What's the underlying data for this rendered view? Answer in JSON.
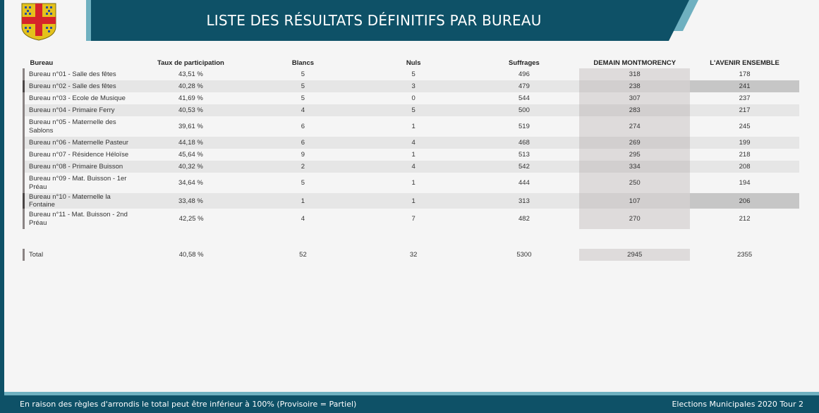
{
  "header": {
    "title": "LISTE DES RÉSULTATS DÉFINITIFS PAR BUREAU",
    "banner_color": "#0e5167",
    "accent_color": "#6fb0c0"
  },
  "logo": {
    "icon": "coat-of-arms-icon"
  },
  "table": {
    "columns": [
      "Bureau",
      "Taux de participation",
      "Blancs",
      "Nuls",
      "Suffrages",
      "DEMAIN MONTMORENCY",
      "L'AVENIR ENSEMBLE"
    ],
    "rows": [
      [
        "Bureau n°01 - Salle des fêtes",
        "43,51 %",
        "5",
        "5",
        "496",
        "318",
        "178"
      ],
      [
        "Bureau n°02 - Salle des fêtes",
        "40,28 %",
        "5",
        "3",
        "479",
        "238",
        "241"
      ],
      [
        "Bureau n°03 - Ecole de Musique",
        "41,69 %",
        "5",
        "0",
        "544",
        "307",
        "237"
      ],
      [
        "Bureau n°04 - Primaire Ferry",
        "40,53 %",
        "4",
        "5",
        "500",
        "283",
        "217"
      ],
      [
        "Bureau n°05 - Maternelle des Sablons",
        "39,61 %",
        "6",
        "1",
        "519",
        "274",
        "245"
      ],
      [
        "Bureau n°06 - Maternelle Pasteur",
        "44,18 %",
        "6",
        "4",
        "468",
        "269",
        "199"
      ],
      [
        "Bureau n°07 - Résidence Héloïse",
        "45,64 %",
        "9",
        "1",
        "513",
        "295",
        "218"
      ],
      [
        "Bureau n°08 - Primaire Buisson",
        "40,32 %",
        "2",
        "4",
        "542",
        "334",
        "208"
      ],
      [
        "Bureau n°09 - Mat. Buisson - 1er Préau",
        "34,64 %",
        "5",
        "1",
        "444",
        "250",
        "194"
      ],
      [
        "Bureau n°10 - Maternelle la Fontaine",
        "33,48 %",
        "1",
        "1",
        "313",
        "107",
        "206"
      ],
      [
        "Bureau n°11 - Mat. Buisson - 2nd Préau",
        "42,25 %",
        "4",
        "7",
        "482",
        "270",
        "212"
      ]
    ],
    "total": [
      "Total",
      "40,58 %",
      "52",
      "32",
      "5300",
      "2945",
      "2355"
    ]
  },
  "footer": {
    "note": "En raison des règles d'arrondis le total peut être inférieur à 100% (Provisoire = Partiel)",
    "meta": "Elections Municipales 2020 Tour 2"
  }
}
